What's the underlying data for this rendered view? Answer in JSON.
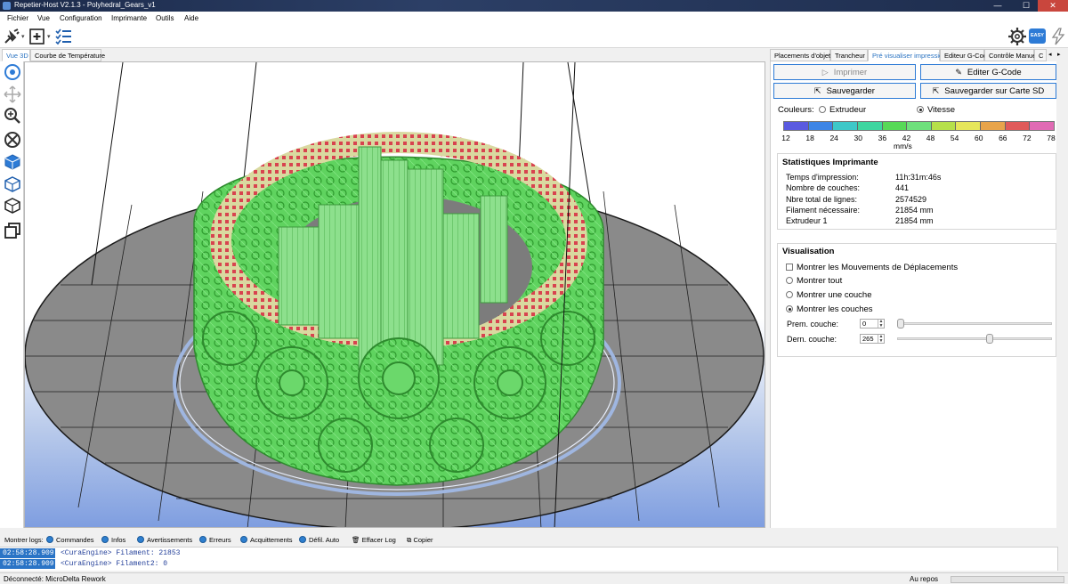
{
  "window": {
    "title": "Repetier-Host V2.1.3 - Polyhedral_Gears_v1",
    "min": "—",
    "max": "☐",
    "close": "✕"
  },
  "menu": [
    "Fichier",
    "Vue",
    "Configuration",
    "Imprimante",
    "Outils",
    "Aide"
  ],
  "toolbar": {
    "easy_label": "EASY"
  },
  "left_tabs": [
    "Vue 3D",
    "Courbe de Température"
  ],
  "right_tabs": [
    "Placements d'objets",
    "Trancheur",
    "Pré visualiser impression",
    "Editeur G-Code",
    "Contrôle Manuel",
    "C"
  ],
  "buttons": {
    "print": "Imprimer",
    "edit_gcode": "Editer G-Code",
    "save": "Sauvegarder",
    "save_sd": "Sauvegarder sur Carte SD"
  },
  "colors": {
    "label": "Couleurs:",
    "option_extruder": "Extrudeur",
    "option_speed": "Vitesse",
    "selected": "Vitesse",
    "bar": [
      "#5a5ae0",
      "#3d85e6",
      "#3ec8c8",
      "#3ed6a0",
      "#57d957",
      "#6ee07c",
      "#b6e04a",
      "#e6e65a",
      "#e8a44a",
      "#e05a5a",
      "#e06ab4"
    ],
    "scale": [
      "12",
      "18",
      "24",
      "30",
      "36",
      "42",
      "48",
      "54",
      "60",
      "66",
      "72",
      "78"
    ],
    "unit": "mm/s"
  },
  "stats": {
    "title": "Statistiques Imprimante",
    "rows": [
      {
        "label": "Temps d'impression:",
        "value": "11h:31m:46s"
      },
      {
        "label": "Nombre de couches:",
        "value": "441"
      },
      {
        "label": "Nbre total de lignes:",
        "value": "2574529"
      },
      {
        "label": "Filament nécessaire:",
        "value": "21854 mm"
      },
      {
        "label": "Extrudeur 1",
        "value": "21854 mm"
      }
    ]
  },
  "visualisation": {
    "title": "Visualisation",
    "show_travel": "Montrer les Mouvements de Déplacements",
    "show_all": "Montrer tout",
    "show_one": "Montrer une couche",
    "show_layers": "Montrer les couches",
    "selected": "Montrer les couches",
    "first_layer_label": "Prem. couche:",
    "first_layer_value": "0",
    "last_layer_label": "Dern. couche:",
    "last_layer_value": "265",
    "first_layer_fraction": 0.0,
    "last_layer_fraction": 0.6
  },
  "logbar": {
    "label": "Montrer logs:",
    "items": [
      "Commandes",
      "Infos",
      "Avertissements",
      "Erreurs",
      "Acquittements",
      "Défil. Auto"
    ],
    "clear": "Effacer Log",
    "copy": "Copier"
  },
  "log": [
    {
      "time": "02:58:28.909",
      "msg": "<CuraEngine> Filament: 21853"
    },
    {
      "time": "02:58:28.909",
      "msg": "<CuraEngine> Filament2: 0"
    }
  ],
  "status": {
    "connection": "Déconnecté: MicroDelta Rework",
    "state": "Au repos"
  },
  "accent": "#2d7bd6"
}
